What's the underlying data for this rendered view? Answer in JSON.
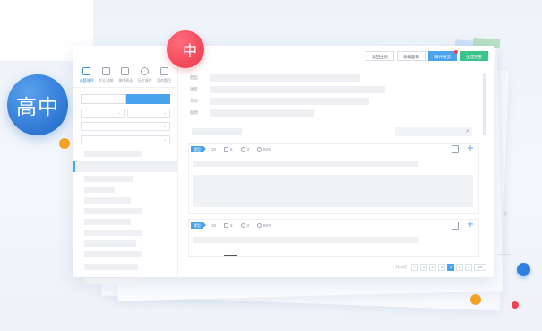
{
  "badges": {
    "level_text": "高中",
    "red_text": "中"
  },
  "sidebar": {
    "tabs": [
      {
        "label": "选题课件",
        "icon": "courseware-icon",
        "active": true
      },
      {
        "label": "作业详解",
        "icon": "homework-icon",
        "active": false
      },
      {
        "label": "课件筛选",
        "icon": "filter-doc-icon",
        "active": false
      },
      {
        "label": "历史课件",
        "icon": "history-clock-icon",
        "active": false
      },
      {
        "label": "我的题目",
        "icon": "my-questions-icon",
        "active": false
      }
    ]
  },
  "toolbar": {
    "back_home": "返回主页",
    "add_question": "添加题目",
    "preview": "课件预览",
    "generate": "生成完整"
  },
  "filters": {
    "labels": [
      "题型",
      "难度",
      "年份",
      "题源"
    ]
  },
  "questions": [
    {
      "tag": "题型",
      "count": "10",
      "files": "5",
      "views": "3",
      "rate": "60%"
    },
    {
      "tag": "题型",
      "count": "10",
      "files": "5",
      "views": "3",
      "rate": "60%"
    }
  ],
  "pagination": {
    "total_label": "共20页",
    "pages": [
      "‹",
      "1",
      "2",
      "3",
      "4",
      "5",
      "›",
      "20"
    ],
    "active_index": 4
  },
  "colors": {
    "accent_blue": "#4aa3ec",
    "badge_blue": "#2e76d2",
    "badge_red": "#f04356",
    "green": "#3cc28b",
    "orange": "#f2a224"
  }
}
